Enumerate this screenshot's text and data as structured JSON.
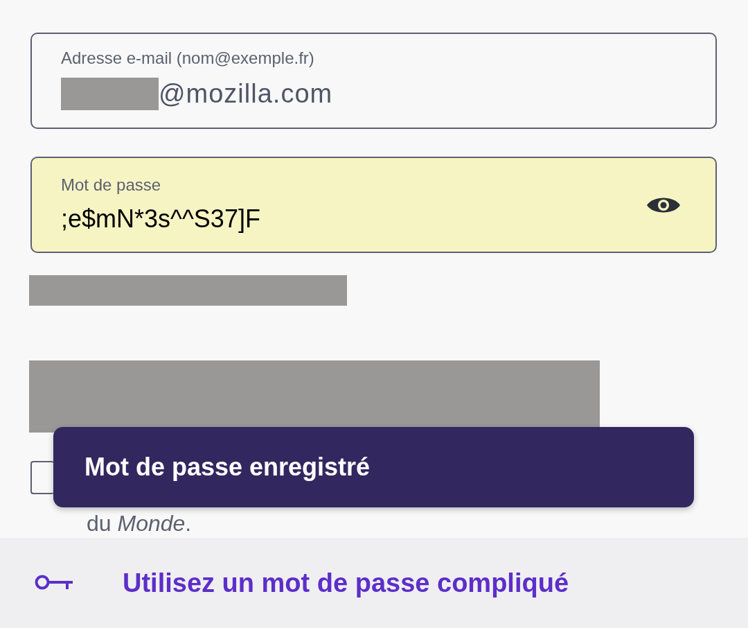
{
  "email_field": {
    "label": "Adresse e-mail (nom@exemple.fr)",
    "value": "@mozilla.com",
    "redacted_prefix": true
  },
  "password_field": {
    "label": "Mot de passe",
    "value": ";e$mN*3s^^S37]F",
    "autofilled": true
  },
  "redactions": [
    {
      "kind": "line"
    },
    {
      "kind": "block"
    }
  ],
  "consent": {
    "checked": false,
    "line_2": "du *Monde*."
  },
  "toast": {
    "text": "Mot de passe enregistré"
  },
  "suggestion_bar": {
    "text": "Utilisez un mot de passe compliqué"
  }
}
